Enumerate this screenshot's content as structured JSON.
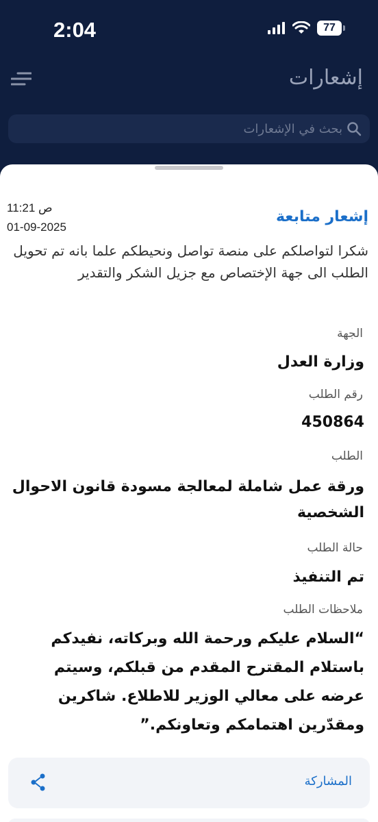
{
  "status_bar": {
    "time": "2:04",
    "battery": "77"
  },
  "header": {
    "title": "إشعارات"
  },
  "search": {
    "placeholder": "بحث في الإشعارات"
  },
  "notification": {
    "title": "إشعار متابعة",
    "time": "11:21 ص",
    "date": "01-09-2025",
    "body": "شكرا لتواصلكم على منصة تواصل ونحيطكم علما بانه تم تحويل الطلب الى جهة الإختصاص مع جزيل الشكر والتقدير",
    "fields": [
      {
        "label": "الجهة",
        "value": "وزارة العدل"
      },
      {
        "label": "رقم الطلب",
        "value": "450864"
      },
      {
        "label": "الطلب",
        "value": "ورقة عمل شاملة لمعالجة مسودة قانون الاحوال الشخصية"
      },
      {
        "label": "حالة الطلب",
        "value": "تم التنفيذ"
      },
      {
        "label": "ملاحظات الطلب",
        "value": "“السلام عليكم ورحمة الله وبركاته، نفيدكم باستلام المقترح المقدم من قبلكم، وسيتم عرضه على معالي الوزير للاطلاع. شاكرين ومقدّرين اهتمامكم وتعاونكم.”"
      }
    ]
  },
  "share": {
    "label": "المشاركة"
  }
}
